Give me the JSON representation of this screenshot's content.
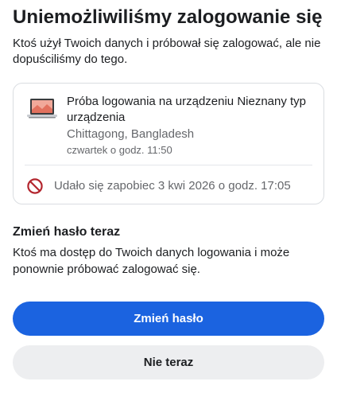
{
  "header": {
    "title": "Uniemożliwiliśmy zalogowanie się",
    "intro": "Ktoś użył Twoich danych i próbował się zalogować, ale nie dopuściliśmy do tego."
  },
  "attempt_card": {
    "device_icon": "laptop-icon",
    "device_name": "Próba logowania na urządzeniu Nieznany typ urządzenia",
    "location": "Chittagong, Bangladesh",
    "time": "czwartek o godz. 11:50",
    "blocked_icon": "blocked-icon",
    "blocked_text": "Udało się zapobiec 3 kwi 2026 o godz. 17:05",
    "blocked_color": "#b3262e"
  },
  "change_password": {
    "title": "Zmień hasło teraz",
    "text": "Ktoś ma dostęp do Twoich danych logowania i może ponownie próbować zalogować się."
  },
  "actions": {
    "primary_label": "Zmień hasło",
    "primary_color": "#1b63e0",
    "secondary_label": "Nie teraz"
  }
}
